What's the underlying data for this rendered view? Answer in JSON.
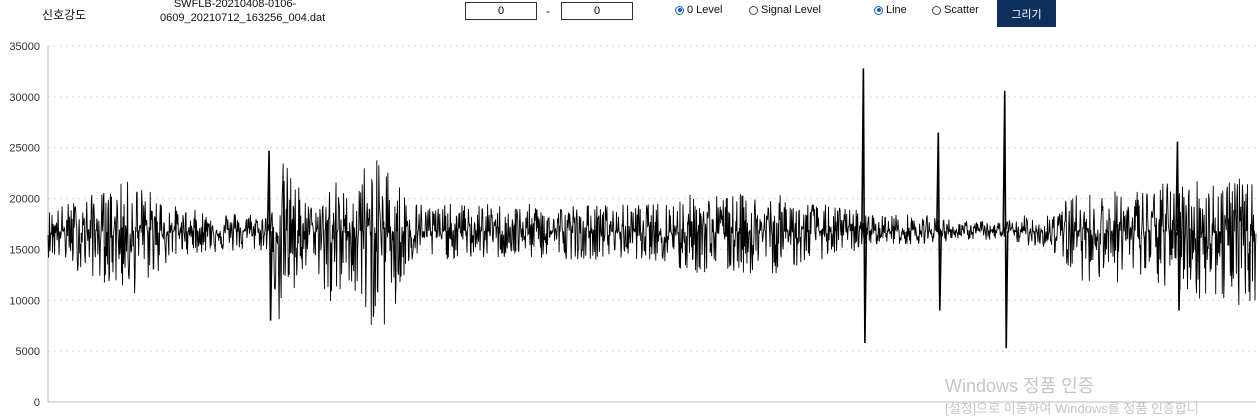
{
  "toolbar": {
    "title": "신호강도",
    "filename": "SWFLB-20210408-0106-\n0609_20210712_163256_004.dat",
    "range_from": "0",
    "range_separator": "-",
    "range_to": "0",
    "level_options": [
      {
        "label": "0 Level",
        "checked": true
      },
      {
        "label": "Signal Level",
        "checked": false
      }
    ],
    "style_options": [
      {
        "label": "Line",
        "checked": true
      },
      {
        "label": "Scatter",
        "checked": false
      }
    ],
    "draw_button": "그리기"
  },
  "watermark": {
    "line1": "Windows 정품 인증",
    "line2": "[설정]으로 이동하여 Windows를 정품 인증합니"
  },
  "chart_data": {
    "type": "line",
    "title": "",
    "xlabel": "",
    "ylabel": "",
    "ylim": [
      0,
      35000
    ],
    "yticks": [
      "0",
      "5000",
      "10000",
      "15000",
      "20000",
      "25000",
      "30000",
      "35000"
    ],
    "grid": "horizontal dotted",
    "legend": "none",
    "color": "#000000",
    "baseline": 16800,
    "envelope": [
      {
        "x": 0,
        "low": 14200,
        "high": 19000
      },
      {
        "x": 0.05,
        "low": 11500,
        "high": 21000
      },
      {
        "x": 0.07,
        "low": 10300,
        "high": 22000
      },
      {
        "x": 0.09,
        "low": 12500,
        "high": 20500
      },
      {
        "x": 0.11,
        "low": 14500,
        "high": 19000
      },
      {
        "x": 0.185,
        "low": 14800,
        "high": 18600
      },
      {
        "x": 0.19,
        "low": 7000,
        "high": 24500
      },
      {
        "x": 0.2,
        "low": 8500,
        "high": 23000
      },
      {
        "x": 0.21,
        "low": 11000,
        "high": 21000
      },
      {
        "x": 0.22,
        "low": 14500,
        "high": 19000
      },
      {
        "x": 0.23,
        "low": 9000,
        "high": 21500
      },
      {
        "x": 0.24,
        "low": 8000,
        "high": 22000
      },
      {
        "x": 0.25,
        "low": 12000,
        "high": 20000
      },
      {
        "x": 0.26,
        "low": 7500,
        "high": 23500
      },
      {
        "x": 0.28,
        "low": 7000,
        "high": 24000
      },
      {
        "x": 0.29,
        "low": 8500,
        "high": 22000
      },
      {
        "x": 0.3,
        "low": 13500,
        "high": 20000
      },
      {
        "x": 0.32,
        "low": 14000,
        "high": 19500
      },
      {
        "x": 0.5,
        "low": 14000,
        "high": 19500
      },
      {
        "x": 0.52,
        "low": 12500,
        "high": 20500
      },
      {
        "x": 0.6,
        "low": 12500,
        "high": 20500
      },
      {
        "x": 0.64,
        "low": 14000,
        "high": 19500
      },
      {
        "x": 0.67,
        "low": 14800,
        "high": 19000
      },
      {
        "x": 0.68,
        "low": 15500,
        "high": 18500
      },
      {
        "x": 0.72,
        "low": 15500,
        "high": 18500
      },
      {
        "x": 0.76,
        "low": 16000,
        "high": 17800
      },
      {
        "x": 0.79,
        "low": 15800,
        "high": 17800
      },
      {
        "x": 0.83,
        "low": 15000,
        "high": 19000
      },
      {
        "x": 0.85,
        "low": 12000,
        "high": 20500
      },
      {
        "x": 0.9,
        "low": 11500,
        "high": 21000
      },
      {
        "x": 0.94,
        "low": 10500,
        "high": 22000
      },
      {
        "x": 0.97,
        "low": 9500,
        "high": 22500
      },
      {
        "x": 1,
        "low": 9500,
        "high": 21500
      }
    ],
    "spikes": [
      {
        "x": 0.675,
        "low": 5800,
        "high": 32800
      },
      {
        "x": 0.737,
        "low": 9000,
        "high": 26500
      },
      {
        "x": 0.792,
        "low": 5300,
        "high": 30600
      },
      {
        "x": 0.183,
        "low": 8000,
        "high": 24700
      },
      {
        "x": 0.935,
        "low": 9000,
        "high": 25600
      }
    ]
  }
}
